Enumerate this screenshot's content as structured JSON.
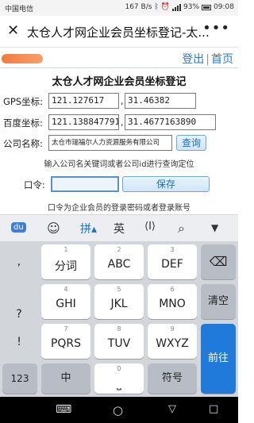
{
  "status": {
    "carrier": "中国电信",
    "speed": "167 B/s",
    "battery": "93%",
    "time": "09:08"
  },
  "titlebar": {
    "close_icon": "close-icon",
    "title": "太仓人才网企业会员坐标登记-太...",
    "more_icon": "more-icon"
  },
  "userbar": {
    "logout": "登出",
    "separator": "|",
    "home": "首页"
  },
  "page": {
    "heading": "太仓人才网企业会员坐标登记",
    "gps_label": "GPS坐标:",
    "gps_lng": "121.127617",
    "gps_lat": "31.46382",
    "baidu_label": "百度坐标:",
    "baidu_lng": "121.138847791",
    "baidu_lat": "31.4677163890",
    "company_label": "公司名称:",
    "company_value": "太仓市瑞福尔人力资源服务有限公司",
    "query_button": "查询",
    "search_hint": "输入公司名关键词或者公司id进行查询定位",
    "password_label": "口令:",
    "password_value": "",
    "save_button": "保存",
    "password_hint": "口令为企业会员的登录密码或者登录账号",
    "comma": ","
  },
  "keyboard": {
    "toolbar": [
      "du-logo-icon",
      "emoji-icon",
      "拼▴",
      "英",
      "cursor-icon",
      "search-icon",
      "hide-keyboard-icon"
    ],
    "punctuation": [
      ",",
      "?",
      "!"
    ],
    "keys": [
      {
        "num": "1",
        "label": "分词"
      },
      {
        "num": "2",
        "label": "ABC"
      },
      {
        "num": "3",
        "label": "DEF"
      },
      {
        "num": "4",
        "label": "GHI"
      },
      {
        "num": "5",
        "label": "JKL"
      },
      {
        "num": "6",
        "label": "MNO"
      },
      {
        "num": "7",
        "label": "PQRS"
      },
      {
        "num": "8",
        "label": "TUV"
      },
      {
        "num": "9",
        "label": "WXYZ"
      }
    ],
    "clear": "清空",
    "go": "前往",
    "numbers": "123",
    "chinese": "中",
    "zero": "0",
    "symbols": "符号"
  }
}
